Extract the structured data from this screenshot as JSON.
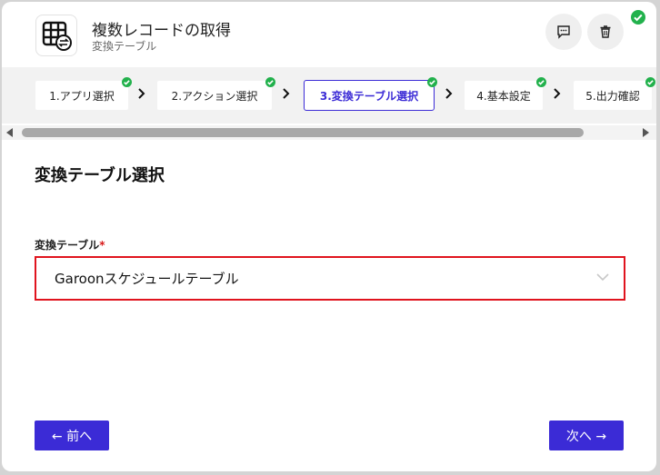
{
  "header": {
    "title": "複数レコードの取得",
    "subtitle": "変換テーブル",
    "icon": "table-sync-icon",
    "chat_icon": "chat-icon",
    "trash_icon": "trash-icon"
  },
  "steps": [
    {
      "label": "1.アプリ選択",
      "complete": true,
      "active": false
    },
    {
      "label": "2.アクション選択",
      "complete": true,
      "active": false
    },
    {
      "label": "3.変換テーブル選択",
      "complete": true,
      "active": true
    },
    {
      "label": "4.基本設定",
      "complete": true,
      "active": false
    },
    {
      "label": "5.出力確認",
      "complete": true,
      "active": false
    }
  ],
  "main": {
    "section_title": "変換テーブル選択",
    "field_label": "変換テーブル",
    "required_mark": "*",
    "selected_value": "Garoonスケジュールテーブル"
  },
  "footer": {
    "prev_label": "← 前へ",
    "next_label": "次へ →"
  },
  "colors": {
    "accent": "#3b2bd6",
    "success": "#22b14c",
    "error_border": "#e0141e"
  }
}
